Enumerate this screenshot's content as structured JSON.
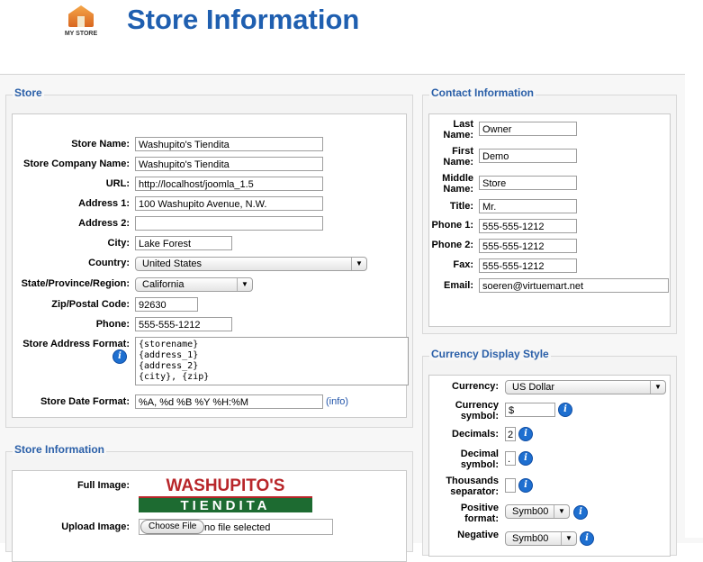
{
  "header": {
    "logo_text": "MY STORE",
    "title": "Store Information"
  },
  "store": {
    "legend": "Store",
    "store_name_label": "Store Name:",
    "store_name": "Washupito's Tiendita",
    "company_label": "Store Company Name:",
    "company": "Washupito's Tiendita",
    "url_label": "URL:",
    "url": "http://localhost/joomla_1.5",
    "address1_label": "Address 1:",
    "address1": "100 Washupito Avenue, N.W.",
    "address2_label": "Address 2:",
    "address2": "",
    "city_label": "City:",
    "city": "Lake Forest",
    "country_label": "Country:",
    "country": "United States",
    "state_label": "State/Province/Region:",
    "state": "California",
    "zip_label": "Zip/Postal Code:",
    "zip": "92630",
    "phone_label": "Phone:",
    "phone": "555-555-1212",
    "address_format_label": "Store Address Format:",
    "address_format": "{storename}\n{address_1}\n{address_2}\n{city}, {zip}",
    "date_format_label": "Store Date Format:",
    "date_format": "%A, %d %B %Y %H:%M",
    "info_link": "(info)"
  },
  "store_info": {
    "legend": "Store Information",
    "full_image_label": "Full Image:",
    "logo_top": "WASHUPITO'S",
    "logo_bottom": "TIENDITA",
    "upload_label": "Upload Image:",
    "choose_file": "Choose File",
    "no_file": "no file selected"
  },
  "contact": {
    "legend": "Contact Information",
    "last_name_label": "Last\nName:",
    "last_name": "Owner",
    "first_name_label": "First\nName:",
    "first_name": "Demo",
    "middle_name_label": "Middle\nName:",
    "middle_name": "Store",
    "title_label": "Title:",
    "title": "Mr.",
    "phone1_label": "Phone 1:",
    "phone1": "555-555-1212",
    "phone2_label": "Phone 2:",
    "phone2": "555-555-1212",
    "fax_label": "Fax:",
    "fax": "555-555-1212",
    "email_label": "Email:",
    "email": "soeren@virtuemart.net"
  },
  "currency": {
    "legend": "Currency Display Style",
    "currency_label": "Currency:",
    "currency": "US Dollar",
    "symbol_label": "Currency\nsymbol:",
    "symbol": "$",
    "decimals_label": "Decimals:",
    "decimals": "2",
    "decimal_symbol_label": "Decimal\nsymbol:",
    "decimal_symbol": ".",
    "thousands_label": "Thousands\nseparator:",
    "thousands": "",
    "positive_label": "Positive\nformat:",
    "positive": "Symb00",
    "negative_label": "Negative",
    "negative": "Symb00"
  },
  "colors": {
    "title": "#1f5fb0",
    "legend": "#2a5fa8",
    "info_icon": "#1e6fd0"
  },
  "icons": [
    "store-house-icon",
    "info-icon",
    "dropdown-arrow-icon"
  ]
}
